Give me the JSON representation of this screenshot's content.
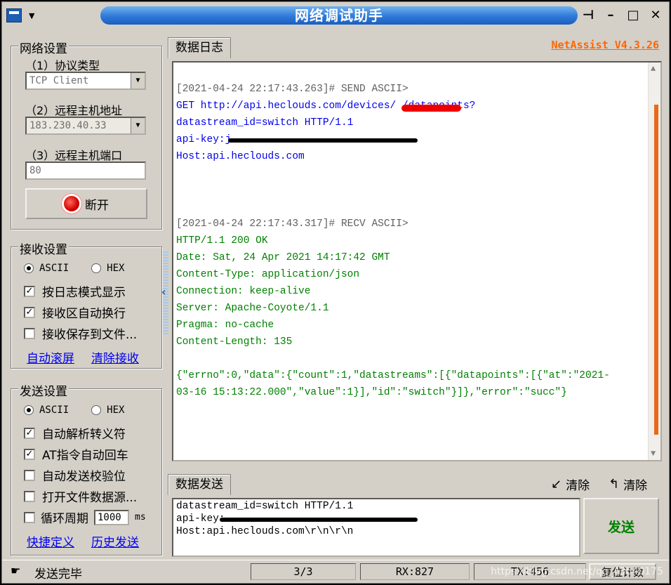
{
  "window": {
    "title": "网络调试助手",
    "version": "NetAssist V4.3.26"
  },
  "network_settings": {
    "group_title": "网络设置",
    "protocol_label": "（1）协议类型",
    "protocol_value": "TCP Client",
    "host_label": "（2）远程主机地址",
    "host_value": "183.230.40.33",
    "port_label": "（3）远程主机端口",
    "port_value": "80",
    "connect_button": "断开"
  },
  "receive_settings": {
    "group_title": "接收设置",
    "ascii": "ASCII",
    "hex": "HEX",
    "log_mode": "按日志模式显示",
    "auto_wrap": "接收区自动换行",
    "save_to_file": "接收保存到文件...",
    "auto_scroll": "自动滚屏",
    "clear_receive": "清除接收"
  },
  "send_settings": {
    "group_title": "发送设置",
    "ascii": "ASCII",
    "hex": "HEX",
    "parse_escape": "自动解析转义符",
    "at_auto_enter": "AT指令自动回车",
    "auto_checksum": "自动发送校验位",
    "open_file_source": "打开文件数据源...",
    "cycle_label": "循环周期",
    "cycle_value": "1000",
    "cycle_unit": "ms",
    "shortcut": "快捷定义",
    "history": "历史发送"
  },
  "log_tab": "数据日志",
  "log": {
    "send_header": "[2021-04-24 22:17:43.263]# SEND ASCII>",
    "send_lines": [
      "GET http://api.heclouds.com/devices/          /datapoints?",
      "datastream_id=switch HTTP/1.1",
      "api-key:j",
      "Host:api.heclouds.com"
    ],
    "recv_header": "[2021-04-24 22:17:43.317]# RECV ASCII>",
    "recv_lines": [
      "HTTP/1.1 200 OK",
      "Date: Sat, 24 Apr 2021 14:17:42 GMT",
      "Content-Type: application/json",
      "Connection: keep-alive",
      "Server: Apache-Coyote/1.1",
      "Pragma: no-cache",
      "Content-Length: 135",
      "",
      "{\"errno\":0,\"data\":{\"count\":1,\"datastreams\":[{\"datapoints\":[{\"at\":\"2021-",
      "03-16 15:13:22.000\",\"value\":1}],\"id\":\"switch\"}]},\"error\":\"succ\"}"
    ]
  },
  "send_tab": "数据发送",
  "clear_send_1": "清除",
  "clear_send_2": "清除",
  "send_text": [
    "datastream_id=switch HTTP/1.1",
    "api-key:",
    "Host:api.heclouds.com\\r\\n\\r\\n"
  ],
  "send_button": "发送",
  "status": {
    "message": "发送完毕",
    "count": "3/3",
    "rx": "RX:827",
    "tx": "TX:456",
    "reset": "复位计数",
    "watermark": "https://blog.csdn.net/qq_43640175"
  },
  "colors": {
    "log_send": "#0000ee",
    "log_recv": "#008000",
    "accent_version": "#ff6600",
    "title_blue": "#2f79d8"
  }
}
